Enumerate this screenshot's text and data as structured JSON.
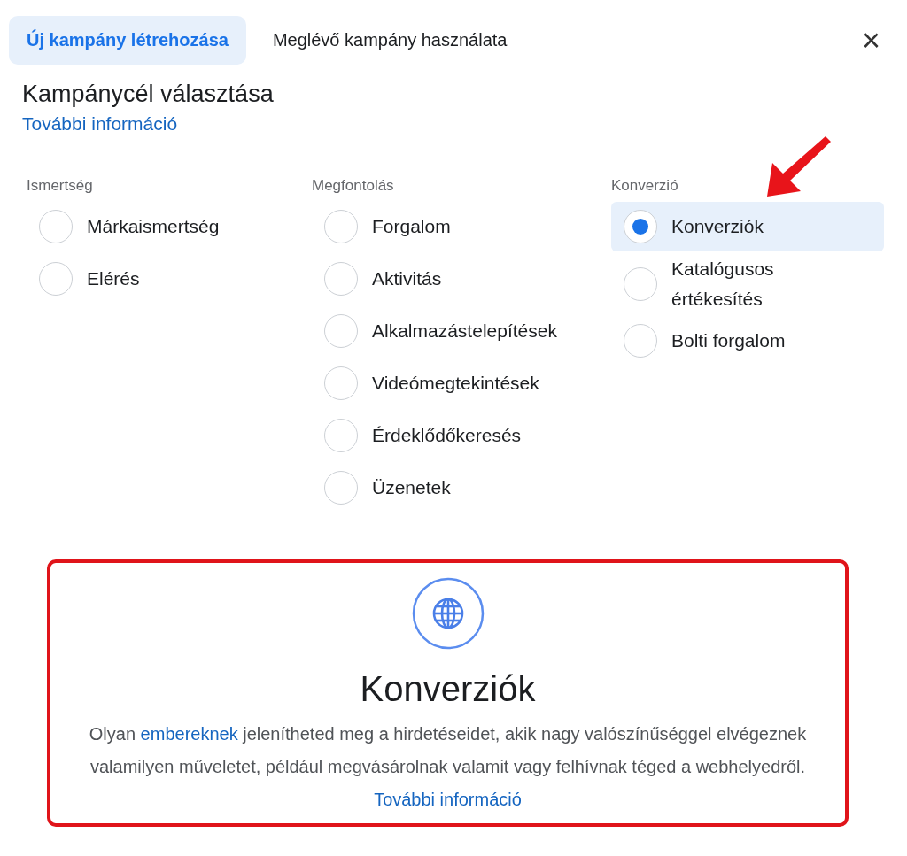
{
  "tabs": [
    {
      "label": "Új kampány létrehozása",
      "selected": true
    },
    {
      "label": "Meglévő kampány használata",
      "selected": false
    }
  ],
  "close": "×",
  "heading": "Kampánycél választása",
  "learn_more": "További információ",
  "columns": [
    {
      "title": "Ismertség",
      "options": [
        {
          "label": "Márkaismertség",
          "selected": false
        },
        {
          "label": "Elérés",
          "selected": false
        }
      ]
    },
    {
      "title": "Megfontolás",
      "options": [
        {
          "label": "Forgalom",
          "selected": false
        },
        {
          "label": "Aktivitás",
          "selected": false
        },
        {
          "label": "Alkalmazástelepítések",
          "selected": false
        },
        {
          "label": "Videómegtekintések",
          "selected": false
        },
        {
          "label": "Érdeklődőkeresés",
          "selected": false
        },
        {
          "label": "Üzenetek",
          "selected": false
        }
      ]
    },
    {
      "title": "Konverzió",
      "options": [
        {
          "label": "Konverziók",
          "selected": true
        },
        {
          "label": "Katalógusos értékesítés",
          "selected": false
        },
        {
          "label": "Bolti forgalom",
          "selected": false
        }
      ]
    }
  ],
  "detail": {
    "highlighted": true,
    "title": "Konverziók",
    "description": [
      {
        "kind": "text",
        "text": "Olyan "
      },
      {
        "kind": "link",
        "text": "embereknek"
      },
      {
        "kind": "text",
        "text": " jelenítheted meg a hirdetéseidet, akik nagy valószínűséggel elvégeznek valamilyen műveletet, például megvásárolnak valamit vagy felhívnak téged a webhelyedről. "
      },
      {
        "kind": "link",
        "text": "További információ"
      }
    ]
  }
}
